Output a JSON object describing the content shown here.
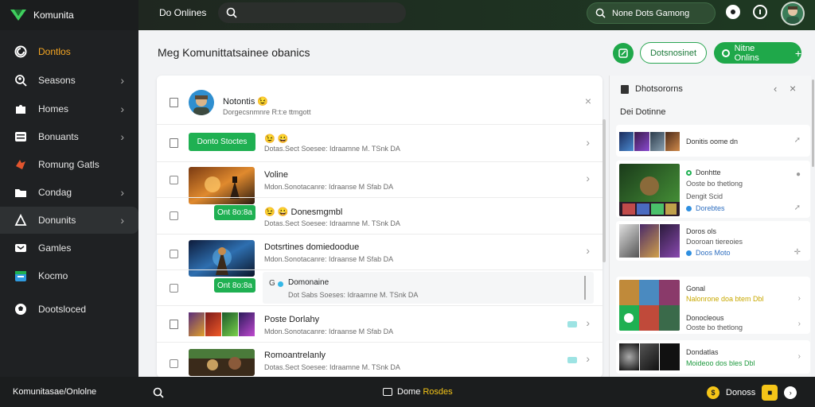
{
  "topbar": {
    "brand": "Komunita",
    "online_label": "Do Onlines",
    "search_placeholder": "",
    "pill_label": "None Dots Gamong"
  },
  "sidebar": {
    "items": [
      {
        "label": "Dontlos",
        "icon": "comment-icon"
      },
      {
        "label": "Seasons",
        "icon": "user-search-icon"
      },
      {
        "label": "Homes",
        "icon": "puzzle-icon"
      },
      {
        "label": "Bonuants",
        "icon": "list-icon"
      },
      {
        "label": "Romung Gatls",
        "icon": "gamepad-icon"
      },
      {
        "label": "Condag",
        "icon": "folder-icon"
      },
      {
        "label": "Donunits",
        "icon": "flag-icon"
      },
      {
        "label": "Gamles",
        "icon": "chat-icon"
      },
      {
        "label": "Kocmo",
        "icon": "calendar-icon"
      },
      {
        "label": "Dootsloced",
        "icon": "soccer-ball-icon"
      }
    ]
  },
  "header": {
    "title": "Meg Komunittatsainee obanics",
    "outline_button": "Dotsnosinet",
    "solid_button": "Nitne Onlins"
  },
  "feed": {
    "profile": {
      "name": "Notontis 😉",
      "sub": "Dorgecsnmnre R:t:e ttmgott"
    },
    "row1": {
      "button": "Donto Stoctes",
      "emoji": "😉 😀",
      "sub": "Dotas.Sect Soesee: Idraamne M. TSnk DA"
    },
    "row2": {
      "title": "Voline",
      "sub": "Mdon.Sonotacanre: Idraanse M Sfab DA"
    },
    "row3": {
      "button": "Ont 8o:8a",
      "title": "😉 😀 Donesmgmbl",
      "sub": "Dotas.Sect Soesee: Idraamne M. TSnk DA"
    },
    "row4": {
      "title": "Dotsrtines domiedoodue",
      "sub": "Mdon.Sonotacanre: Idraanse M Sfab DA"
    },
    "row5": {
      "button": "Ont 8o:8a",
      "title": "Domonaine",
      "sub": "Dot Sabs Soeses: Idraamne M. TSnk DA"
    },
    "row6": {
      "title": "Poste Dorlahy",
      "sub": "Mdon.Sonotacanre: Idraanse M Sfab DA"
    },
    "row7": {
      "title": "Romoantrelanly",
      "sub": "Dotas.Sect Soesee: Idraamne M. TSnk DA"
    }
  },
  "panel": {
    "title": "Dhotsororns",
    "subtitle": "Dei Dotinne",
    "card1": {
      "line1": "Donitis oome dn"
    },
    "card2": {
      "line1": "Donhtte",
      "line2": "Ooste bo thetlong",
      "line3": "Dengit Scid",
      "line4": "Dorebtes"
    },
    "card3": {
      "line1": "Doros ols",
      "line2": "Dooroan tiereoies",
      "line3": "Doos Moto"
    },
    "card4": {
      "line1": "Gonal",
      "line2": "Nalonrone doa btem Dbl",
      "line3": "Donocleous",
      "line4": "Ooste bo thetlong"
    },
    "card5": {
      "line1": "Dondatlas",
      "line2": "Moideoo dos bles Dbl"
    }
  },
  "bottombar": {
    "left": "Komunitasae/Onlolne",
    "center_a": "Dome",
    "center_b": "Rosdes",
    "right": "Donoss"
  },
  "colors": {
    "accent_green": "#1fa84a",
    "sidebar_active": "#f5a623",
    "yellow": "#f5c518"
  }
}
